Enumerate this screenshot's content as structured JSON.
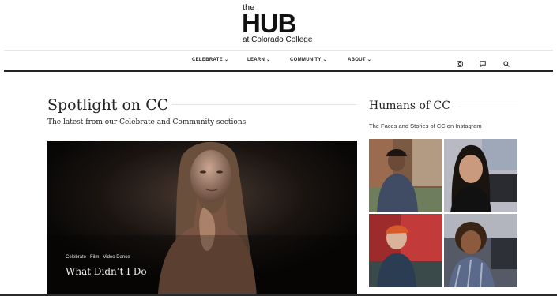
{
  "logo": {
    "line1": "the",
    "line2": "HUB",
    "line3": "at Colorado College"
  },
  "nav": {
    "items": [
      {
        "label": "CELEBRATE"
      },
      {
        "label": "LEARN"
      },
      {
        "label": "COMMUNITY"
      },
      {
        "label": "ABOUT"
      }
    ],
    "icons": [
      "instagram-icon",
      "chat-icon",
      "search-icon"
    ]
  },
  "spotlight": {
    "title": "Spotlight on CC",
    "subtitle": "The latest from our Celebrate and Community sections",
    "feature": {
      "tags": [
        "Celebrate",
        "Film",
        "Video Dance"
      ],
      "title": "What Didn’t I Do"
    }
  },
  "humans": {
    "title": "Humans of CC",
    "subtitle": "The Faces and Stories of CC on Instagram"
  },
  "colors": {
    "accent": "#222222",
    "hero_bg": "#0c0a09",
    "rule": "#e6e6e6"
  }
}
